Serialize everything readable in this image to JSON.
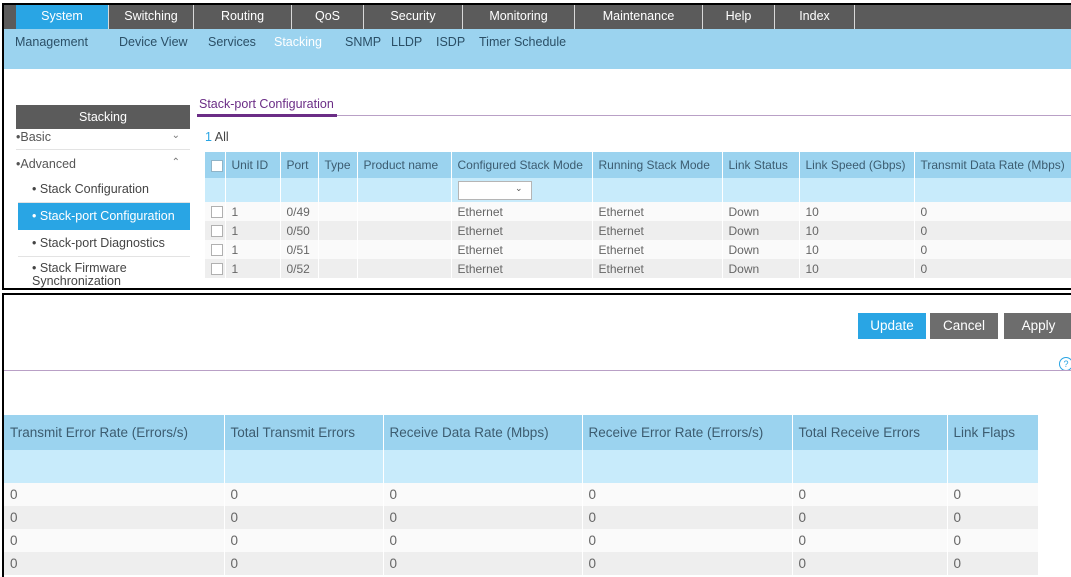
{
  "nav": {
    "main_tabs": [
      "System",
      "Switching",
      "Routing",
      "QoS",
      "Security",
      "Monitoring",
      "Maintenance",
      "Help",
      "Index"
    ],
    "active_main": "System",
    "sub_tabs": [
      "Management",
      "Device View",
      "Services",
      "Stacking",
      "SNMP",
      "LLDP",
      "ISDP",
      "Timer Schedule"
    ],
    "active_sub": "Stacking"
  },
  "sidebar": {
    "title": "Stacking",
    "basic": "Basic",
    "advanced": "Advanced",
    "items": [
      "Stack Configuration",
      "Stack-port Configuration",
      "Stack-port Diagnostics",
      "Stack Firmware Synchronization"
    ]
  },
  "page": {
    "tab": "Stack-port Configuration",
    "all_num": "1",
    "all_label": "All"
  },
  "table1": {
    "headers": [
      "Unit ID",
      "Port",
      "Type",
      "Product name",
      "Configured Stack Mode",
      "Running Stack Mode",
      "Link Status",
      "Link Speed (Gbps)",
      "Transmit Data Rate (Mbps)"
    ],
    "rows": [
      [
        "1",
        "0/49",
        "",
        "",
        "Ethernet",
        "Ethernet",
        "Down",
        "10",
        "0"
      ],
      [
        "1",
        "0/50",
        "",
        "",
        "Ethernet",
        "Ethernet",
        "Down",
        "10",
        "0"
      ],
      [
        "1",
        "0/51",
        "",
        "",
        "Ethernet",
        "Ethernet",
        "Down",
        "10",
        "0"
      ],
      [
        "1",
        "0/52",
        "",
        "",
        "Ethernet",
        "Ethernet",
        "Down",
        "10",
        "0"
      ]
    ]
  },
  "buttons": {
    "update": "Update",
    "cancel": "Cancel",
    "apply": "Apply"
  },
  "table2": {
    "headers": [
      "Transmit Error Rate (Errors/s)",
      "Total Transmit Errors",
      "Receive Data Rate (Mbps)",
      "Receive Error Rate (Errors/s)",
      "Total Receive Errors",
      "Link Flaps"
    ],
    "rows": [
      [
        "0",
        "0",
        "0",
        "0",
        "0",
        "0"
      ],
      [
        "0",
        "0",
        "0",
        "0",
        "0",
        "0"
      ],
      [
        "0",
        "0",
        "0",
        "0",
        "0",
        "0"
      ],
      [
        "0",
        "0",
        "0",
        "0",
        "0",
        "0"
      ]
    ]
  },
  "colors": {
    "accent": "#29a5e4",
    "nav_dark": "#5b5b5b",
    "subnav": "#9bd3ef",
    "purple": "#6b2d86"
  }
}
